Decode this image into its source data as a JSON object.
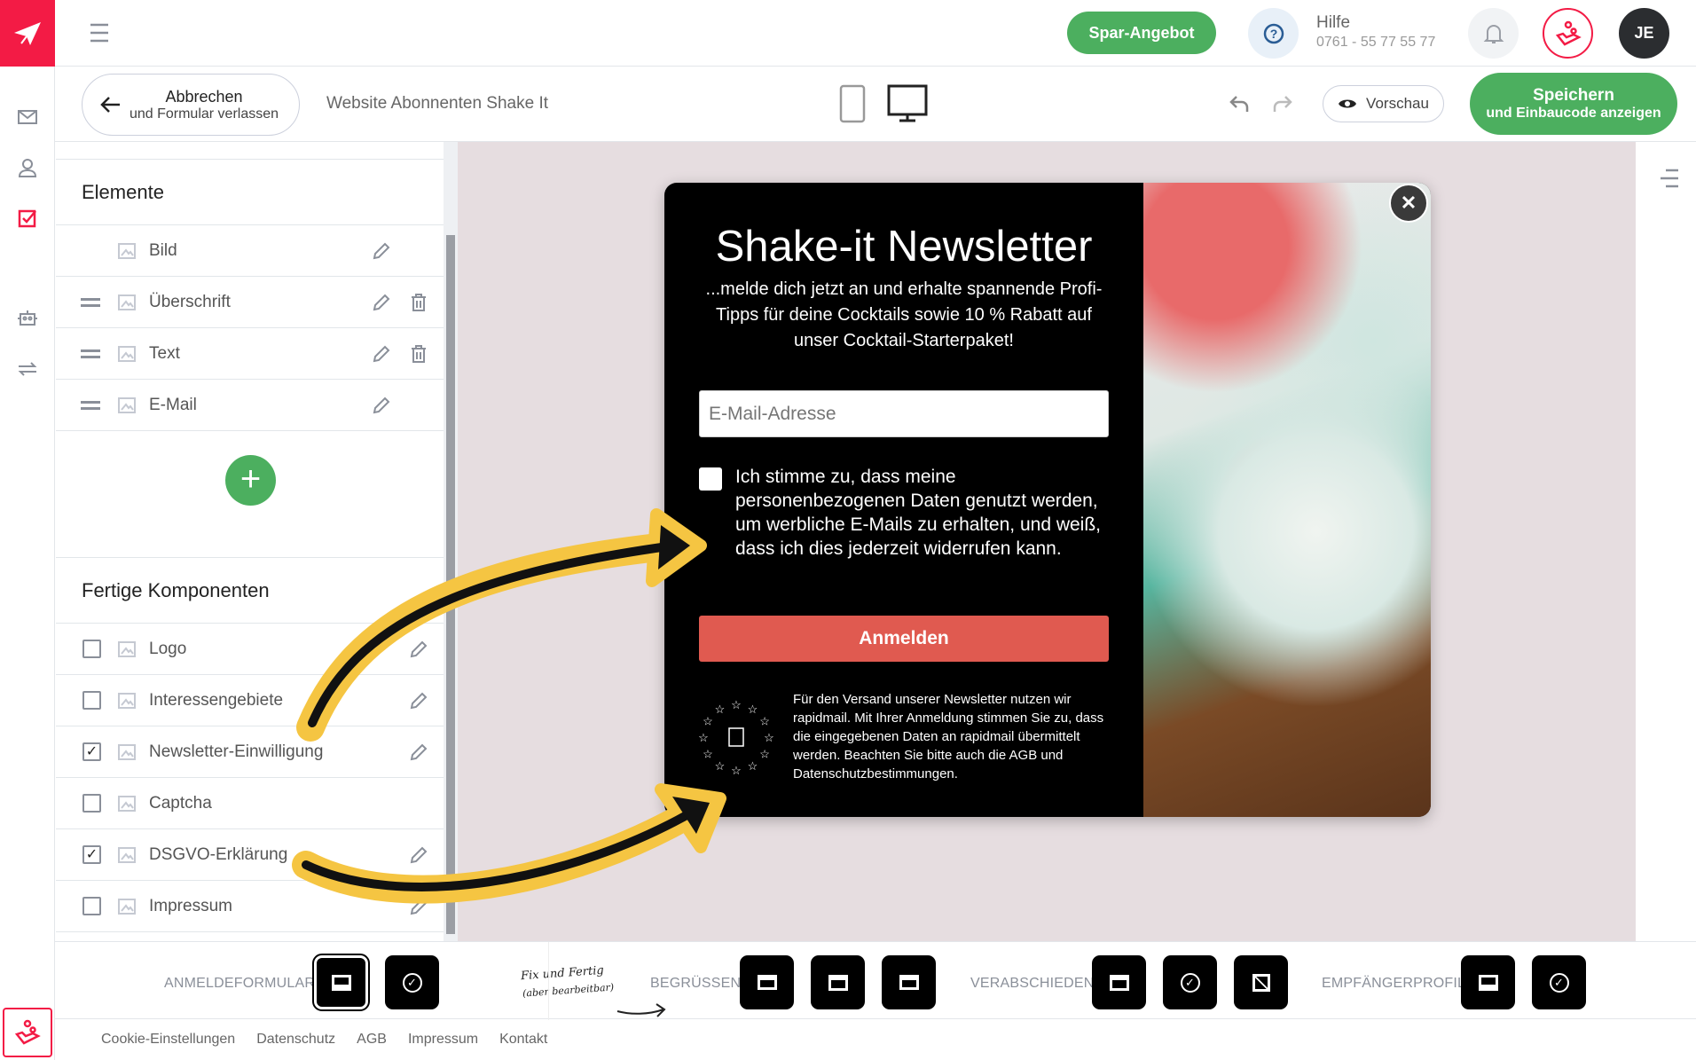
{
  "colors": {
    "brand": "#f31b45",
    "green": "#4caf5f",
    "canvas": "#e6dde0",
    "submit": "#e05a50",
    "arrow": "#f5c542"
  },
  "rail": {
    "items": [
      "mail-icon",
      "user-icon",
      "checklist-icon",
      "robot-icon",
      "transfer-icon"
    ]
  },
  "topbar": {
    "offer": "Spar-Angebot",
    "help_title": "Hilfe",
    "help_phone": "0761 - 55 77 55 77",
    "avatar": "JE"
  },
  "toolbar": {
    "cancel_title": "Abbrechen",
    "cancel_sub": "und Formular verlassen",
    "form_name": "Website Abonnenten Shake It",
    "preview": "Vorschau",
    "save_title": "Speichern",
    "save_sub": "und Einbaucode anzeigen"
  },
  "panel": {
    "elements_title": "Elemente",
    "elements": [
      {
        "label": "Bild",
        "icon": "image-icon",
        "drag": false,
        "delete": false
      },
      {
        "label": "Überschrift",
        "icon": "heading-icon",
        "drag": true,
        "delete": true
      },
      {
        "label": "Text",
        "icon": "text-icon",
        "drag": true,
        "delete": true
      },
      {
        "label": "E-Mail",
        "icon": "mail-icon",
        "drag": true,
        "delete": false
      }
    ],
    "components_title": "Fertige Komponenten",
    "components": [
      {
        "label": "Logo",
        "checked": false,
        "icon": "image-icon",
        "edit": true
      },
      {
        "label": "Interessengebiete",
        "checked": false,
        "icon": "list-icon",
        "edit": true
      },
      {
        "label": "Newsletter-Einwilligung",
        "checked": true,
        "icon": "thumbs-up-icon",
        "edit": true
      },
      {
        "label": "Captcha",
        "checked": false,
        "icon": "lock-icon",
        "edit": false
      },
      {
        "label": "DSGVO-Erklärung",
        "checked": true,
        "icon": "shield-check-icon",
        "edit": true
      },
      {
        "label": "Impressum",
        "checked": false,
        "icon": "shield-icon",
        "edit": true
      }
    ]
  },
  "popup": {
    "title": "Shake-it Newsletter",
    "subtitle": "...melde dich jetzt an und erhalte spannende Profi-Tipps für deine Cocktails sowie 10 % Rabatt auf unser Cocktail-Starterpaket!",
    "email_placeholder": "E-Mail-Adresse",
    "consent": "Ich stimme zu, dass meine personenbezogenen Daten genutzt werden, um werbliche E-Mails zu erhalten, und weiß, dass ich dies jederzeit widerrufen kann.",
    "submit": "Anmelden",
    "legal_pre": "Für den Versand unserer Newsletter nutzen wir rapidmail. Mit Ihrer Anmeldung stimmen Sie zu, dass die eingegebenen Daten an rapidmail übermittelt werden. Beachten Sie bitte auch die ",
    "legal_agb": "AGB",
    "legal_mid": " und ",
    "legal_privacy": "Datenschutzbestimmungen",
    "legal_end": "."
  },
  "bottombar": {
    "signup": "ANMELDEFORMULAR",
    "note_line1": "Fix und Fertig",
    "note_line2": "(aber bearbeitbar)",
    "welcome": "BEGRÜSSEN",
    "goodbye": "VERABSCHIEDEN",
    "profile": "EMPFÄNGERPROFIL"
  },
  "footer": [
    "Cookie-Einstellungen",
    "Datenschutz",
    "AGB",
    "Impressum",
    "Kontakt"
  ]
}
